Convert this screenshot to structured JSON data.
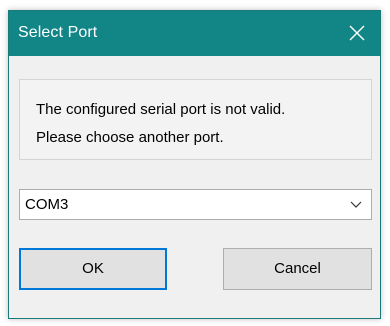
{
  "window": {
    "title": "Select Port",
    "close_icon": "close-icon",
    "titlebar_color": "#128586"
  },
  "message": {
    "line1": "The configured serial port is not valid.",
    "line2": "Please choose another port."
  },
  "port_select": {
    "selected": "COM3",
    "icon": "chevron-down-icon"
  },
  "buttons": {
    "ok_label": "OK",
    "cancel_label": "Cancel",
    "focus_color": "#0078d7"
  }
}
